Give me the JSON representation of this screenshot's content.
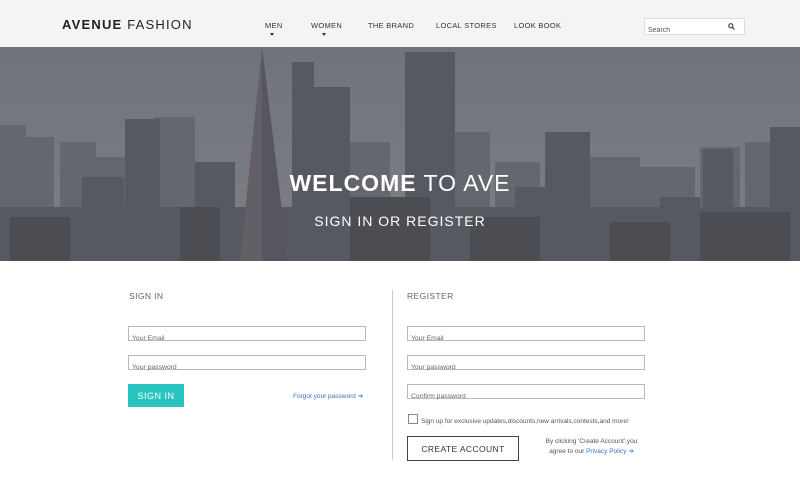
{
  "brand": {
    "bold": "AVENUE",
    "rest": " FASHION"
  },
  "nav": [
    {
      "label": "MEN"
    },
    {
      "label": "WOMEN"
    },
    {
      "label": "THE BRAND"
    },
    {
      "label": "LOCAL STORES"
    },
    {
      "label": "LOOK BOOK"
    }
  ],
  "search": {
    "placeholder": "Search",
    "icon": "search-icon"
  },
  "hero": {
    "title_bold": "WELCOME",
    "title_rest": " TO AVE",
    "subtitle": "SIGN IN OR REGISTER"
  },
  "signin": {
    "heading": "SIGN IN",
    "email_placeholder": "Your Email",
    "password_placeholder": "Your password",
    "button_label": "SIGN IN",
    "forgot_label": "Forgot your password",
    "forgot_icon": "arrow-right-icon"
  },
  "register": {
    "heading": "REGISTER",
    "email_placeholder": "Your Email",
    "password_placeholder": "Your password",
    "confirm_placeholder": "Confirm password",
    "checkbox_label": "Sign up for exclusive updates,discounts,new arrivals,contests,and more!",
    "button_label": "CREATE ACCOUNT",
    "terms_line1": "By clicking 'Create Account',you",
    "terms_line2_prefix": "agree to our ",
    "privacy_link": "Privacy Policy",
    "privacy_icon": "arrow-right-icon"
  },
  "colors": {
    "accent": "#29c4c0",
    "link": "#3a70c0",
    "header_bg": "#f4f4f4"
  }
}
